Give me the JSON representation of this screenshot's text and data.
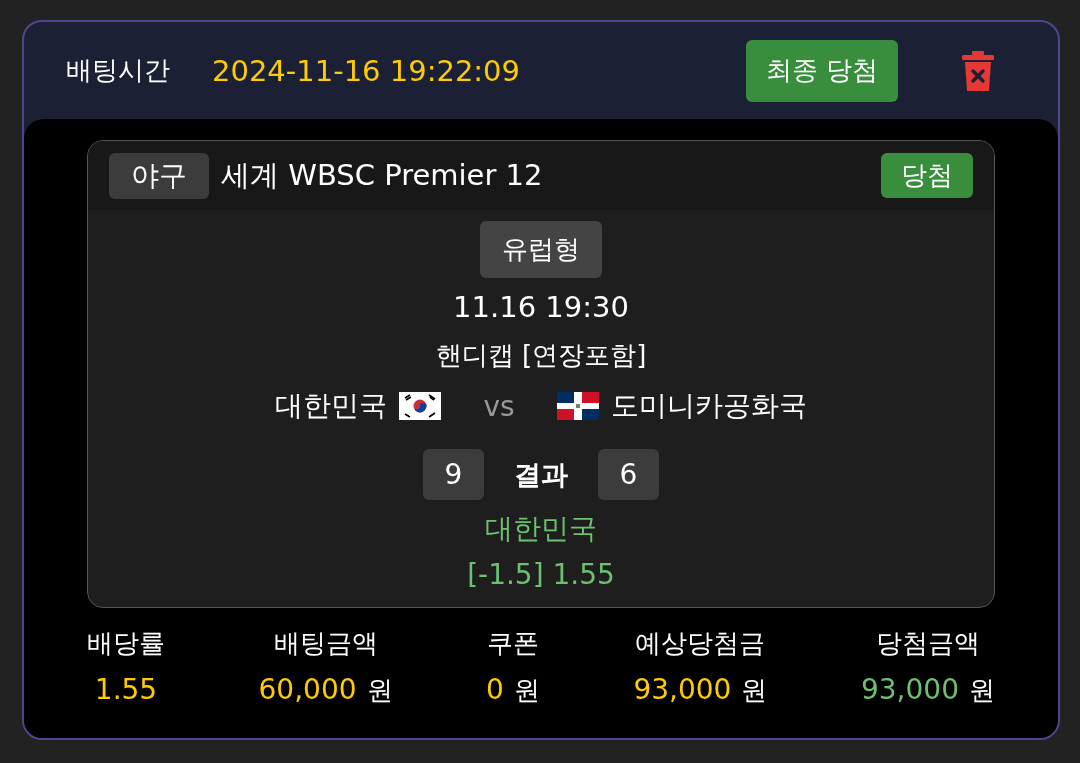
{
  "header": {
    "label": "배팅시간",
    "datetime": "2024-11-16 19:22:09",
    "final_button": "최종 당첨"
  },
  "match": {
    "sport": "야구",
    "league": "세계 WBSC Premier 12",
    "status": "당첨",
    "bet_type": "유럽형",
    "time": "11.16 19:30",
    "market": "핸디캡 [연장포함]",
    "home": {
      "name": "대한민국",
      "score": "9"
    },
    "vs": "vs",
    "away": {
      "name": "도미니카공화국",
      "score": "6"
    },
    "result_label": "결과",
    "pick": "대한민국",
    "pick_odds": "[-1.5] 1.55"
  },
  "stats": [
    {
      "label": "배당률",
      "value": "1.55",
      "color": "#ffcc00"
    },
    {
      "label": "배팅금액",
      "value": "60,000",
      "unit": "원",
      "color": "#ffcc00"
    },
    {
      "label": "쿠폰",
      "value": "0",
      "unit": "원",
      "color": "#ffcc00"
    },
    {
      "label": "예상당첨금",
      "value": "93,000",
      "unit": "원",
      "color": "#ffcc00"
    },
    {
      "label": "당첨금액",
      "value": "93,000",
      "unit": "원",
      "color": "#6cc070"
    }
  ]
}
